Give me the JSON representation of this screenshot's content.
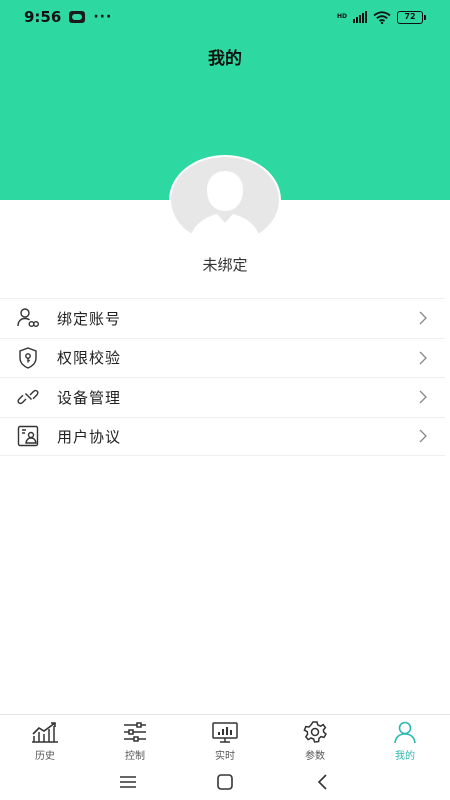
{
  "status_bar": {
    "time": "9:56",
    "more": "···",
    "battery": "72",
    "network": "HD"
  },
  "header": {
    "title": "我的",
    "background_color": "#2dd9a0"
  },
  "profile": {
    "avatar_icon": "default-avatar-icon",
    "bind_status": "未绑定"
  },
  "menu": {
    "items": [
      {
        "icon": "user-link-icon",
        "label": "绑定账号"
      },
      {
        "icon": "shield-key-icon",
        "label": "权限校验"
      },
      {
        "icon": "link-icon",
        "label": "设备管理"
      },
      {
        "icon": "agreement-icon",
        "label": "用户协议"
      }
    ]
  },
  "tabbar": {
    "active_color": "#2bb8b0",
    "tabs": [
      {
        "icon": "chart-trend-icon",
        "label": "历史"
      },
      {
        "icon": "sliders-icon",
        "label": "控制"
      },
      {
        "icon": "monitor-icon",
        "label": "实时"
      },
      {
        "icon": "gear-icon",
        "label": "参数"
      },
      {
        "icon": "user-icon",
        "label": "我的"
      }
    ],
    "active_index": 4
  },
  "system_nav": {
    "buttons": [
      "menu-icon",
      "home-icon",
      "back-icon"
    ]
  }
}
